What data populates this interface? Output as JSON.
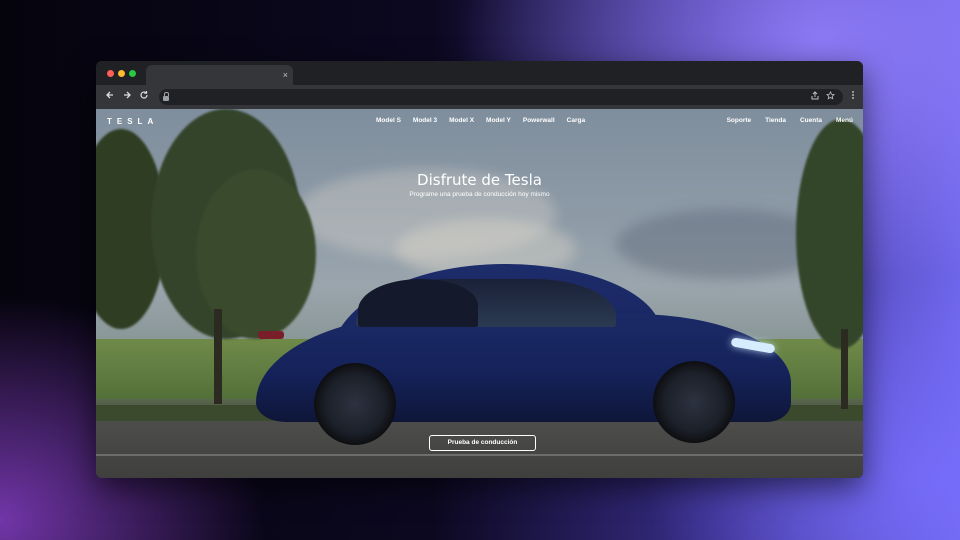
{
  "browser": {
    "tab_close_glyph": "×",
    "nav_back_icon": "back-arrow-icon",
    "nav_forward_icon": "forward-arrow-icon",
    "reload_icon": "reload-icon",
    "share_icon": "share-icon",
    "bookmark_icon": "star-icon",
    "menu_icon": "kebab-menu-icon"
  },
  "site": {
    "logo_text": "TESLA",
    "nav_center": [
      "Model S",
      "Model 3",
      "Model X",
      "Model Y",
      "Powerwall",
      "Carga"
    ],
    "nav_right": [
      "Soporte",
      "Tienda",
      "Cuenta",
      "Menú"
    ]
  },
  "hero": {
    "title": "Disfrute de Tesla",
    "subtitle": "Programe una prueba de conducción hoy mismo",
    "cta_label": "Prueba de conducción"
  },
  "colors": {
    "tab_active": "#35363a",
    "chrome_bg": "#202124",
    "car_blue": "#1b2a66"
  }
}
